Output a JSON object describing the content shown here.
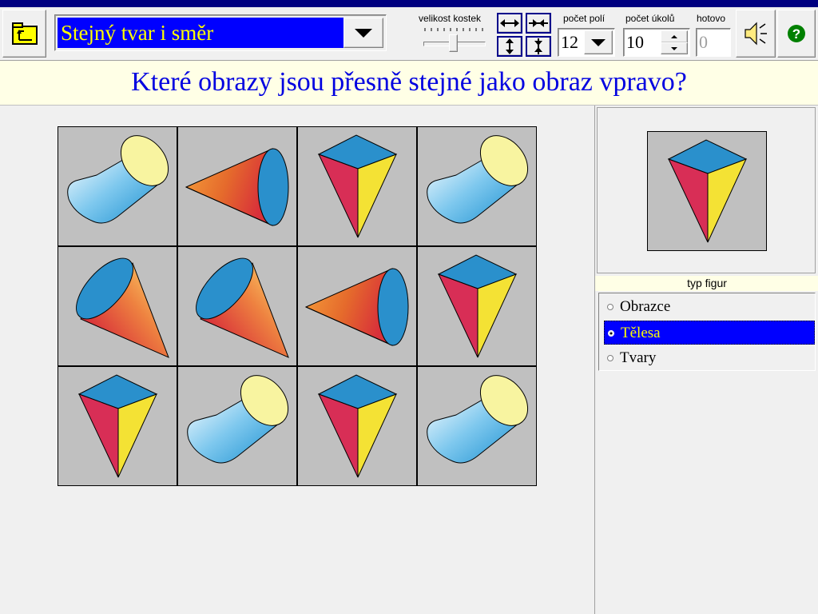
{
  "toolbar": {
    "mode_title": "Stejný tvar i směr",
    "size_label": "velikost kostek",
    "fields_label": "počet polí",
    "fields_value": "12",
    "tasks_label": "počet úkolů",
    "tasks_value": "10",
    "done_label": "hotovo",
    "done_value": "0",
    "help_glyph": "?"
  },
  "question": "Které obrazy jsou přesně stejné jako obraz vpravo?",
  "board": {
    "rows": 3,
    "cols": 4,
    "cells": [
      {
        "shape": "cylinder",
        "direction": "up-right"
      },
      {
        "shape": "cone",
        "direction": "right"
      },
      {
        "shape": "pyramid",
        "direction": "down"
      },
      {
        "shape": "cylinder",
        "direction": "up-right"
      },
      {
        "shape": "cone",
        "direction": "up-left"
      },
      {
        "shape": "cone",
        "direction": "up-left"
      },
      {
        "shape": "cone",
        "direction": "right"
      },
      {
        "shape": "pyramid",
        "direction": "down"
      },
      {
        "shape": "pyramid",
        "direction": "down"
      },
      {
        "shape": "cylinder",
        "direction": "up-right"
      },
      {
        "shape": "pyramid",
        "direction": "down"
      },
      {
        "shape": "cylinder",
        "direction": "up-right"
      }
    ]
  },
  "target": {
    "shape": "pyramid",
    "direction": "down"
  },
  "figure_type": {
    "label": "typ figur",
    "options": [
      "Obrazce",
      "Tělesa",
      "Tvary"
    ],
    "selected": "Tělesa"
  },
  "colors": {
    "accent": "#0000ff",
    "mode_text": "#ffff00",
    "question_text": "#0000e0",
    "banner_bg": "#ffffe6",
    "cell_bg": "#c0c0c0"
  },
  "icons": [
    "back-folder-icon",
    "dropdown-arrow-icon",
    "widen-arrows-icon",
    "narrow-arrows-icon",
    "heighten-arrows-icon",
    "shorten-arrows-icon",
    "speaker-icon",
    "help-icon"
  ]
}
